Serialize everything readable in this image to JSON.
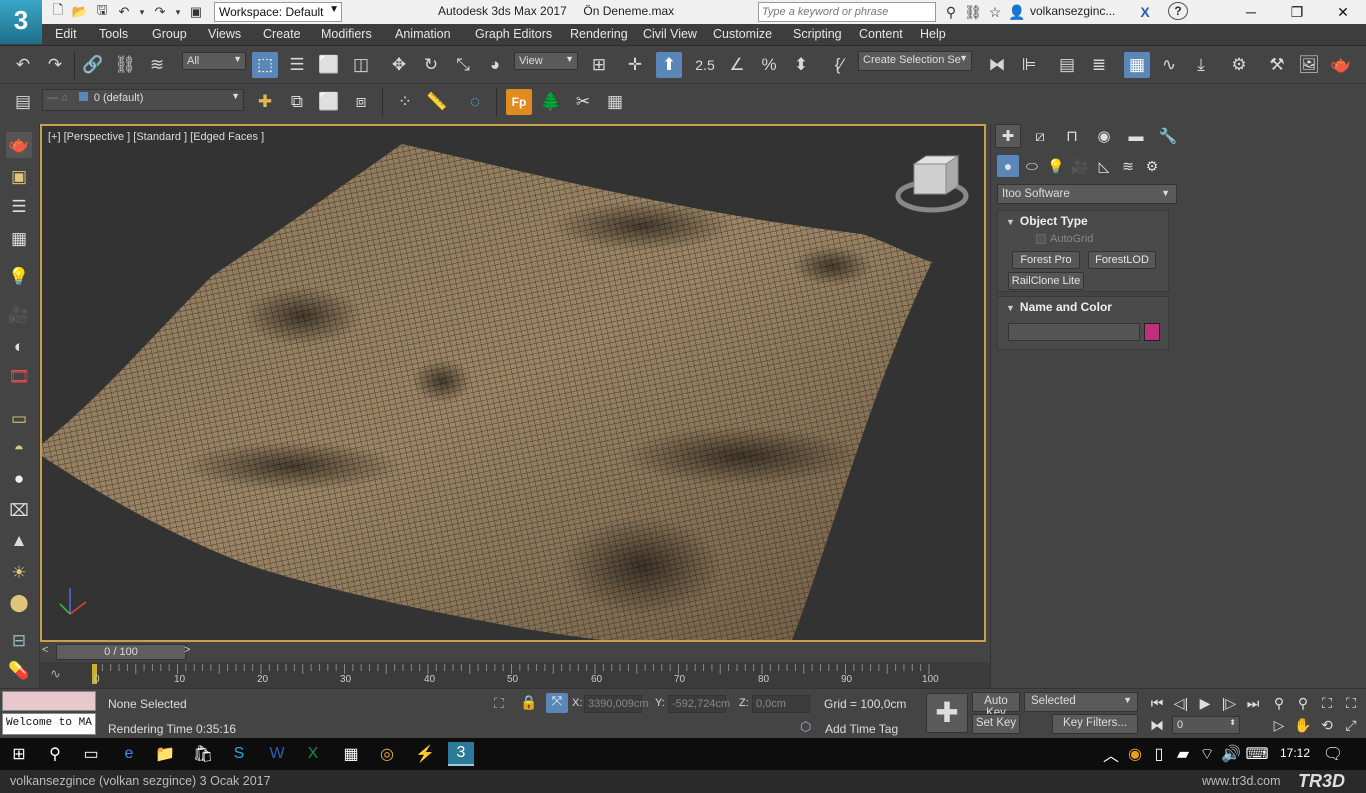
{
  "title_bar": {
    "logo": "3",
    "workspace": "Workspace: Default",
    "window_title": "Autodesk 3ds Max 2017     Ön Deneme.max",
    "search_placeholder": "Type a keyword or phrase",
    "user": "volkansezginc...",
    "help": "?"
  },
  "menu": [
    "Edit",
    "Tools",
    "Group",
    "Views",
    "Create",
    "Modifiers",
    "Animation",
    "Graph Editors",
    "Rendering",
    "Civil View",
    "Customize",
    "Scripting",
    "Content",
    "Help"
  ],
  "toolbar": {
    "filter": "All",
    "ref_coord": "View",
    "snap_num": "2.5",
    "selection_set": "Create Selection Se"
  },
  "layer_toolbar": {
    "layer": "0 (default)"
  },
  "viewport": {
    "label": "[+] [Perspective ] [Standard ] [Edged Faces ]",
    "mesh_color": "#8e7a5e",
    "border_color": "#c8a04a"
  },
  "command_panel": {
    "category": "Itoo Software",
    "object_type": {
      "title": "Object Type",
      "autogrid": "AutoGrid",
      "buttons": [
        "Forest Pro",
        "ForestLOD",
        "RailClone Lite"
      ]
    },
    "name_color": {
      "title": "Name and Color",
      "name_value": "",
      "color": "#c0307a"
    }
  },
  "timeline": {
    "slider": "0 / 100",
    "ticks": [
      "0",
      "10",
      "20",
      "30",
      "40",
      "50",
      "60",
      "70",
      "80",
      "90",
      "100"
    ]
  },
  "status": {
    "maxscript": "Welcome to MA",
    "selected": "None Selected",
    "render_time": "Rendering Time  0:35:16",
    "x_label": "X:",
    "x": "3390,009cm",
    "y_label": "Y:",
    "y": "-592,724cm",
    "z_label": "Z:",
    "z": "0,0cm",
    "grid": "Grid = 100,0cm",
    "add_time_tag": "Add Time Tag",
    "auto_key": "Auto Key",
    "set_key": "Set Key",
    "key_mode": "Selected",
    "key_filters": "Key Filters...",
    "frame": "0"
  },
  "taskbar": {
    "clock": "17:12"
  },
  "caption": {
    "left": "volkansezgince (volkan sezgince)  3 Ocak 2017",
    "right": "www.tr3d.com",
    "brand": "TR3D"
  }
}
